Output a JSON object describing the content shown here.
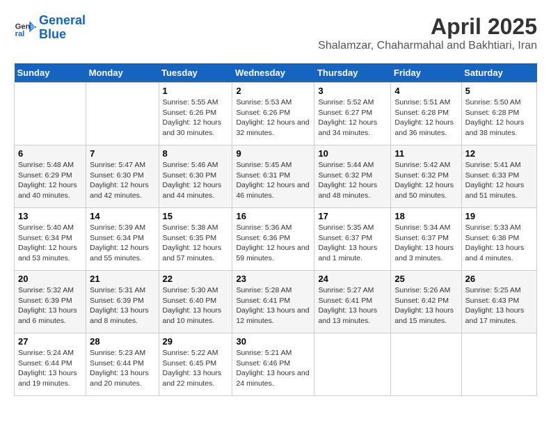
{
  "logo": {
    "line1": "General",
    "line2": "Blue"
  },
  "title": "April 2025",
  "subtitle": "Shalamzar, Chaharmahal and Bakhtiari, Iran",
  "days_of_week": [
    "Sunday",
    "Monday",
    "Tuesday",
    "Wednesday",
    "Thursday",
    "Friday",
    "Saturday"
  ],
  "weeks": [
    [
      {
        "day": "",
        "info": ""
      },
      {
        "day": "",
        "info": ""
      },
      {
        "day": "1",
        "info": "Sunrise: 5:55 AM\nSunset: 6:26 PM\nDaylight: 12 hours and 30 minutes."
      },
      {
        "day": "2",
        "info": "Sunrise: 5:53 AM\nSunset: 6:26 PM\nDaylight: 12 hours and 32 minutes."
      },
      {
        "day": "3",
        "info": "Sunrise: 5:52 AM\nSunset: 6:27 PM\nDaylight: 12 hours and 34 minutes."
      },
      {
        "day": "4",
        "info": "Sunrise: 5:51 AM\nSunset: 6:28 PM\nDaylight: 12 hours and 36 minutes."
      },
      {
        "day": "5",
        "info": "Sunrise: 5:50 AM\nSunset: 6:28 PM\nDaylight: 12 hours and 38 minutes."
      }
    ],
    [
      {
        "day": "6",
        "info": "Sunrise: 5:48 AM\nSunset: 6:29 PM\nDaylight: 12 hours and 40 minutes."
      },
      {
        "day": "7",
        "info": "Sunrise: 5:47 AM\nSunset: 6:30 PM\nDaylight: 12 hours and 42 minutes."
      },
      {
        "day": "8",
        "info": "Sunrise: 5:46 AM\nSunset: 6:30 PM\nDaylight: 12 hours and 44 minutes."
      },
      {
        "day": "9",
        "info": "Sunrise: 5:45 AM\nSunset: 6:31 PM\nDaylight: 12 hours and 46 minutes."
      },
      {
        "day": "10",
        "info": "Sunrise: 5:44 AM\nSunset: 6:32 PM\nDaylight: 12 hours and 48 minutes."
      },
      {
        "day": "11",
        "info": "Sunrise: 5:42 AM\nSunset: 6:32 PM\nDaylight: 12 hours and 50 minutes."
      },
      {
        "day": "12",
        "info": "Sunrise: 5:41 AM\nSunset: 6:33 PM\nDaylight: 12 hours and 51 minutes."
      }
    ],
    [
      {
        "day": "13",
        "info": "Sunrise: 5:40 AM\nSunset: 6:34 PM\nDaylight: 12 hours and 53 minutes."
      },
      {
        "day": "14",
        "info": "Sunrise: 5:39 AM\nSunset: 6:34 PM\nDaylight: 12 hours and 55 minutes."
      },
      {
        "day": "15",
        "info": "Sunrise: 5:38 AM\nSunset: 6:35 PM\nDaylight: 12 hours and 57 minutes."
      },
      {
        "day": "16",
        "info": "Sunrise: 5:36 AM\nSunset: 6:36 PM\nDaylight: 12 hours and 59 minutes."
      },
      {
        "day": "17",
        "info": "Sunrise: 5:35 AM\nSunset: 6:37 PM\nDaylight: 13 hours and 1 minute."
      },
      {
        "day": "18",
        "info": "Sunrise: 5:34 AM\nSunset: 6:37 PM\nDaylight: 13 hours and 3 minutes."
      },
      {
        "day": "19",
        "info": "Sunrise: 5:33 AM\nSunset: 6:38 PM\nDaylight: 13 hours and 4 minutes."
      }
    ],
    [
      {
        "day": "20",
        "info": "Sunrise: 5:32 AM\nSunset: 6:39 PM\nDaylight: 13 hours and 6 minutes."
      },
      {
        "day": "21",
        "info": "Sunrise: 5:31 AM\nSunset: 6:39 PM\nDaylight: 13 hours and 8 minutes."
      },
      {
        "day": "22",
        "info": "Sunrise: 5:30 AM\nSunset: 6:40 PM\nDaylight: 13 hours and 10 minutes."
      },
      {
        "day": "23",
        "info": "Sunrise: 5:28 AM\nSunset: 6:41 PM\nDaylight: 13 hours and 12 minutes."
      },
      {
        "day": "24",
        "info": "Sunrise: 5:27 AM\nSunset: 6:41 PM\nDaylight: 13 hours and 13 minutes."
      },
      {
        "day": "25",
        "info": "Sunrise: 5:26 AM\nSunset: 6:42 PM\nDaylight: 13 hours and 15 minutes."
      },
      {
        "day": "26",
        "info": "Sunrise: 5:25 AM\nSunset: 6:43 PM\nDaylight: 13 hours and 17 minutes."
      }
    ],
    [
      {
        "day": "27",
        "info": "Sunrise: 5:24 AM\nSunset: 6:44 PM\nDaylight: 13 hours and 19 minutes."
      },
      {
        "day": "28",
        "info": "Sunrise: 5:23 AM\nSunset: 6:44 PM\nDaylight: 13 hours and 20 minutes."
      },
      {
        "day": "29",
        "info": "Sunrise: 5:22 AM\nSunset: 6:45 PM\nDaylight: 13 hours and 22 minutes."
      },
      {
        "day": "30",
        "info": "Sunrise: 5:21 AM\nSunset: 6:46 PM\nDaylight: 13 hours and 24 minutes."
      },
      {
        "day": "",
        "info": ""
      },
      {
        "day": "",
        "info": ""
      },
      {
        "day": "",
        "info": ""
      }
    ]
  ]
}
